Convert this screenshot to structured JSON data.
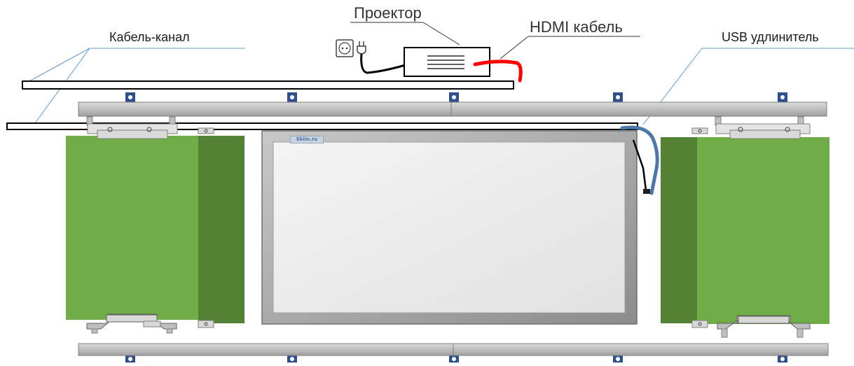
{
  "labels": {
    "projector": "Проектор",
    "hdmi_cable": "HDMI кабель",
    "cable_channel": "Кабель-канал",
    "usb_extender": "USB удлинитель"
  },
  "board_brand": "Skiin.ru",
  "colors": {
    "panel_green_light": "#70ad47",
    "panel_green_dark": "#548235",
    "board_frame": "#a5a5a5",
    "board_surface": "#ececec",
    "rail": "#bfbfbf",
    "mount_blue": "#2f4f8f",
    "hdmi_red": "#ff0000",
    "usb_blue": "#4a78a8",
    "leader_line": "#5b9bd5"
  }
}
